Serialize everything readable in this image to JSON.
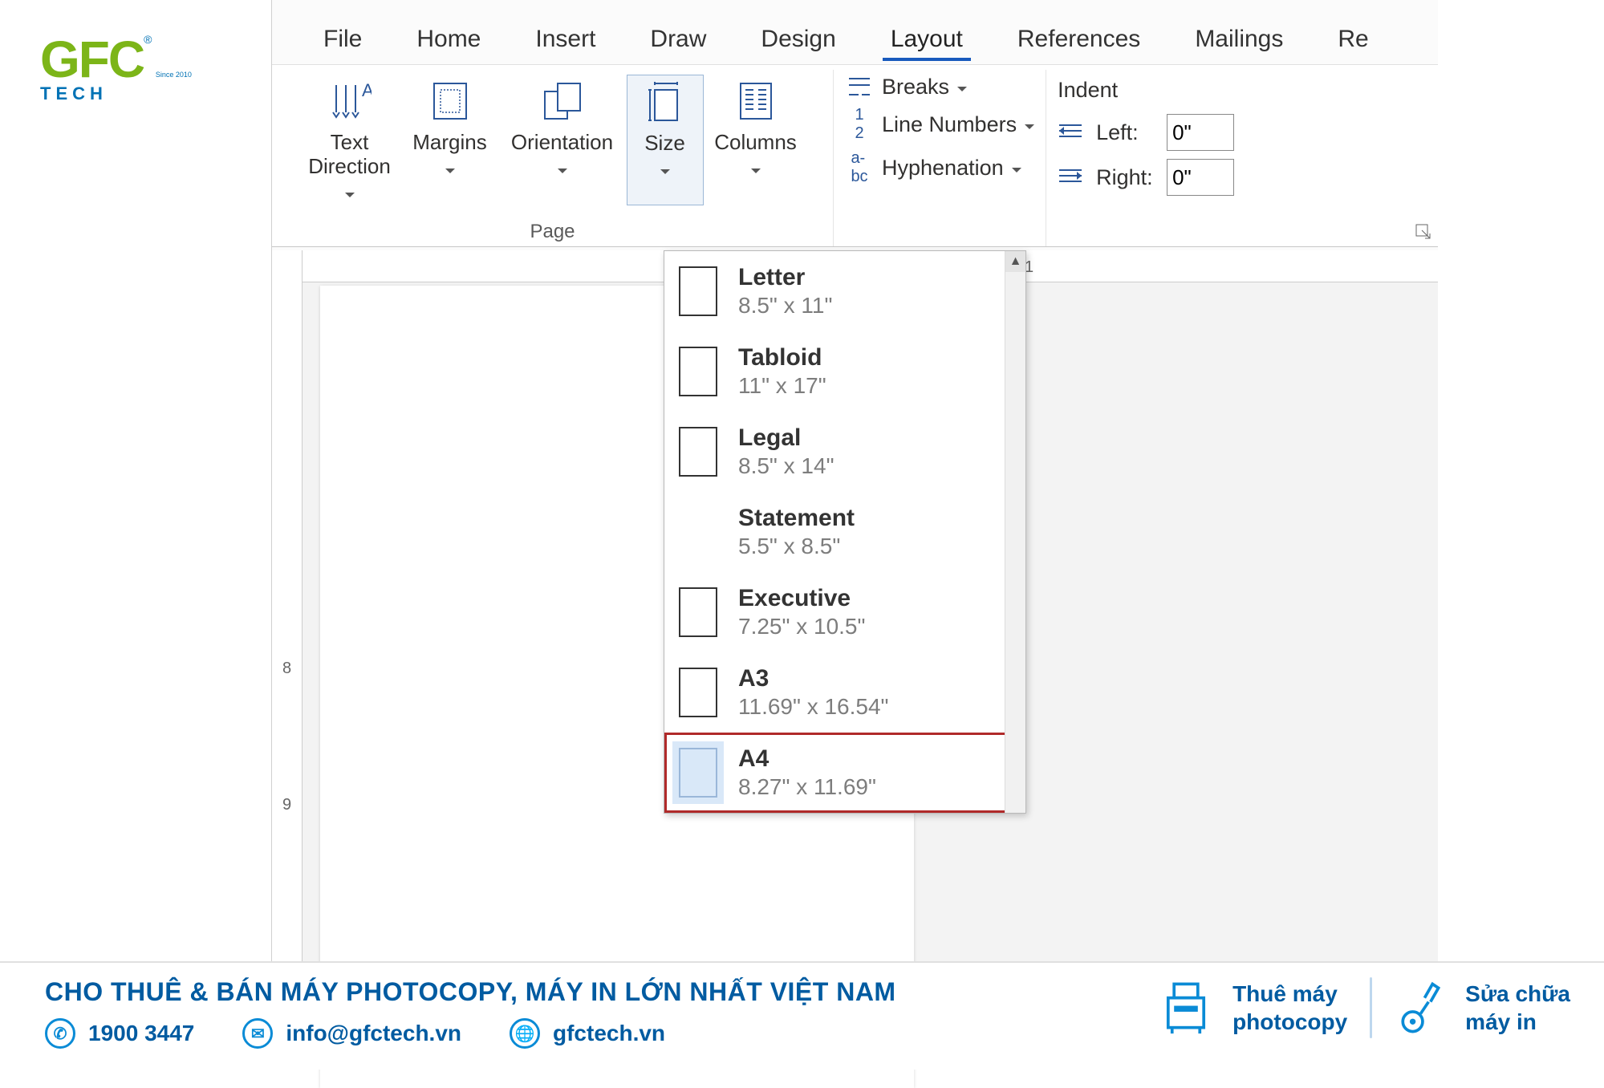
{
  "logo": {
    "brand": "GFC",
    "sub": "TECH",
    "since": "Since 2010",
    "reg": "®"
  },
  "tabs": [
    "File",
    "Home",
    "Insert",
    "Draw",
    "Design",
    "Layout",
    "References",
    "Mailings",
    "Re"
  ],
  "active_tab": 5,
  "ribbon": {
    "page_setup_label": "Page",
    "text_direction": "Text\nDirection",
    "margins": "Margins",
    "orientation": "Orientation",
    "size": "Size",
    "columns": "Columns",
    "breaks": "Breaks",
    "line_numbers": "Line Numbers",
    "hyphenation": "Hyphenation",
    "indent_title": "Indent",
    "left_label": "Left:",
    "right_label": "Right:",
    "left_val": "0\"",
    "right_val": "0\""
  },
  "size_options": [
    {
      "name": "Letter",
      "dims": "8.5\" x 11\"",
      "thumb": true
    },
    {
      "name": "Tabloid",
      "dims": "11\" x 17\"",
      "thumb": true
    },
    {
      "name": "Legal",
      "dims": "8.5\" x 14\"",
      "thumb": true
    },
    {
      "name": "Statement",
      "dims": "5.5\" x 8.5\"",
      "thumb": false
    },
    {
      "name": "Executive",
      "dims": "7.25\" x 10.5\"",
      "thumb": true
    },
    {
      "name": "A3",
      "dims": "11.69\" x 16.54\"",
      "thumb": true
    },
    {
      "name": "A4",
      "dims": "8.27\" x 11.69\"",
      "thumb": true,
      "selected": true
    }
  ],
  "ruler_h": [
    "1"
  ],
  "ruler_v": [
    "8",
    "9"
  ],
  "footer": {
    "tagline": "CHO THUÊ & BÁN MÁY PHOTOCOPY, MÁY IN LỚN NHẤT VIỆT NAM",
    "phone": "1900 3447",
    "email": "info@gfctech.vn",
    "web": "gfctech.vn",
    "svc1a": "Thuê máy",
    "svc1b": "photocopy",
    "svc2a": "Sửa chữa",
    "svc2b": "máy in"
  }
}
